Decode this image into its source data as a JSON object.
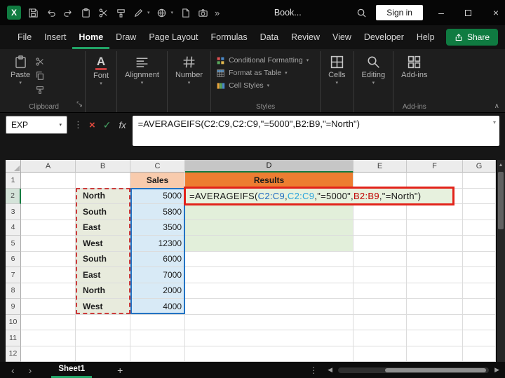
{
  "colors": {
    "accent_green": "#107C41",
    "share_green": "#0F7B41",
    "tab_underline_green": "#21A366",
    "ref_blue": "#2273C4",
    "ref_red": "#C00000",
    "annotation_red": "#E2231A",
    "sales_header_fill": "#F8CBAD",
    "results_header_fill": "#ED7D31",
    "region_fill": "#E8EBDD",
    "sales_fill": "#D8EAF6",
    "results_fill": "#E2EFDA"
  },
  "titlebar": {
    "workbook_name": "Book...",
    "sign_in_label": "Sign in",
    "icons": [
      "excel-logo",
      "save",
      "undo",
      "redo",
      "clipboard",
      "scissors",
      "format-painter",
      "pen",
      "globe",
      "document",
      "camera",
      "overflow",
      "search"
    ],
    "window_controls": [
      "minimize",
      "maximize",
      "close"
    ]
  },
  "menubar": {
    "tabs": [
      "File",
      "Insert",
      "Home",
      "Draw",
      "Page Layout",
      "Formulas",
      "Data",
      "Review",
      "View",
      "Developer",
      "Help"
    ],
    "active_tab": "Home",
    "share_label": "Share"
  },
  "ribbon": {
    "paste_label": "Paste",
    "clipboard_group_label": "Clipboard",
    "small_icons": [
      "cut",
      "copy",
      "format-painter"
    ],
    "collapsed_groups": [
      {
        "label": "Font"
      },
      {
        "label": "Alignment"
      },
      {
        "label": "Number"
      }
    ],
    "styles_items": [
      {
        "label": "Conditional Formatting"
      },
      {
        "label": "Format as Table"
      },
      {
        "label": "Cell Styles"
      }
    ],
    "styles_group_label": "Styles",
    "right_groups": [
      {
        "label": "Cells"
      },
      {
        "label": "Editing"
      },
      {
        "label": "Add-ins"
      }
    ],
    "addins_group_label": "Add-ins"
  },
  "formula_bar": {
    "name_box_value": "EXP",
    "fx_label": "fx",
    "formula": "=AVERAGEIFS(C2:C9,C2:C9,\"=5000\",B2:B9,\"=North\")"
  },
  "grid": {
    "column_headers": [
      "A",
      "B",
      "C",
      "D",
      "E",
      "F",
      "G"
    ],
    "selected_column": "D",
    "selected_row": 2,
    "row_count": 12,
    "header_row": {
      "c": "Sales",
      "d": "Results"
    },
    "data_rows": [
      {
        "row": 2,
        "region": "North",
        "sales": "5000"
      },
      {
        "row": 3,
        "region": "South",
        "sales": "5800"
      },
      {
        "row": 4,
        "region": "East",
        "sales": "3500"
      },
      {
        "row": 5,
        "region": "West",
        "sales": "12300"
      },
      {
        "row": 6,
        "region": "South",
        "sales": "6000"
      },
      {
        "row": 7,
        "region": "East",
        "sales": "7000"
      },
      {
        "row": 8,
        "region": "North",
        "sales": "2000"
      },
      {
        "row": 9,
        "region": "West",
        "sales": "4000"
      }
    ],
    "green_fill_rows": [
      2,
      3,
      4,
      5
    ],
    "formula_cell": {
      "row": 2,
      "col": "D",
      "parts": [
        {
          "text": "=AVERAGEIFS(",
          "color": "#1a1a1a"
        },
        {
          "text": "C2:C9",
          "color": "#1F6BC0"
        },
        {
          "text": ",",
          "color": "#1a1a1a"
        },
        {
          "text": "C2:C9",
          "color": "#2AA3DC"
        },
        {
          "text": ",\"=5000\",",
          "color": "#1a1a1a"
        },
        {
          "text": "B2:B9",
          "color": "#C00000"
        },
        {
          "text": ",\"=North\")",
          "color": "#1a1a1a"
        }
      ]
    }
  },
  "sheet_bar": {
    "tabs": [
      {
        "name": "Sheet1",
        "active": true
      }
    ],
    "add_sheet_label": "+"
  }
}
